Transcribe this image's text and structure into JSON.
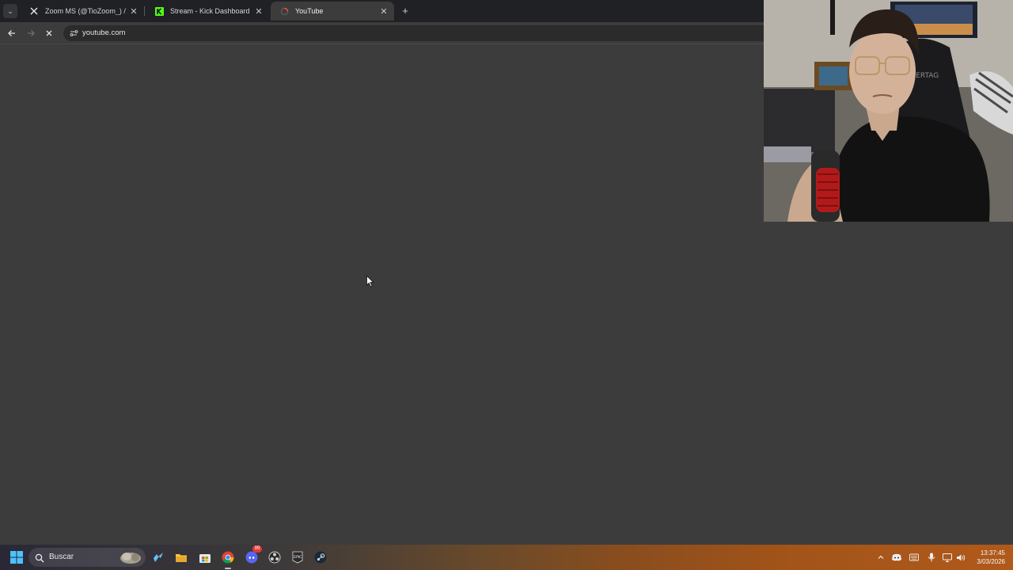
{
  "browser": {
    "tabs": [
      {
        "title": "Zoom MS (@TioZoom_) / X",
        "icon": "x-logo-icon",
        "active": false
      },
      {
        "title": "Stream - Kick Dashboard",
        "icon": "kick-logo-icon",
        "active": false
      },
      {
        "title": "YouTube",
        "icon": "loading-spinner-icon",
        "active": true
      }
    ],
    "address": {
      "url": "youtube.com"
    }
  },
  "webcam": {
    "icon": "webcam-feed"
  },
  "taskbar": {
    "search_label": "Buscar",
    "chat_badge": "99",
    "pinned": [
      "windows-start-icon",
      "search-icon",
      "steam-icon",
      "file-explorer-icon",
      "microsoft-store-icon",
      "chrome-icon",
      "discord-icon",
      "obs-icon",
      "epic-games-icon",
      "steam-icon"
    ],
    "clock": {
      "time": "13:37:45",
      "date": "3/03/2026"
    }
  }
}
